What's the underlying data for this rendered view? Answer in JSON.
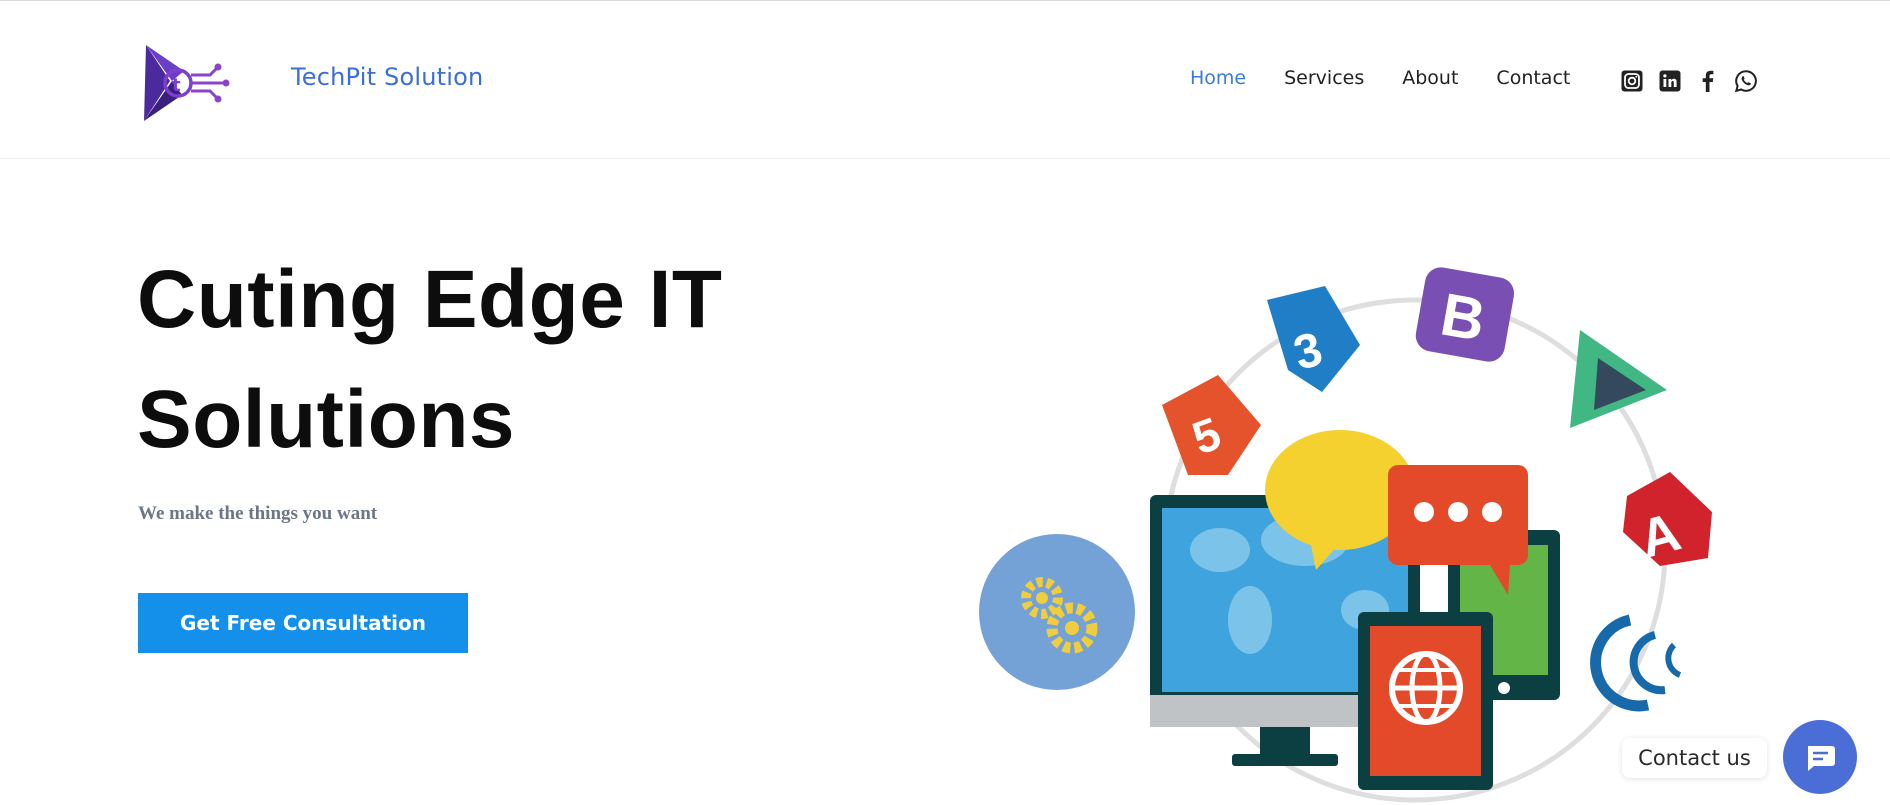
{
  "brand": {
    "name": "TechPit Solution",
    "logo_icon": "techpit-logo-icon"
  },
  "nav": {
    "items": [
      {
        "label": "Home",
        "active": true
      },
      {
        "label": "Services",
        "active": false
      },
      {
        "label": "About",
        "active": false
      },
      {
        "label": "Contact",
        "active": false
      }
    ]
  },
  "social": [
    "instagram-icon",
    "linkedin-icon",
    "facebook-icon",
    "whatsapp-icon"
  ],
  "hero": {
    "title_line1": "Cuting Edge IT",
    "title_line2": "Solutions",
    "subtitle": "We make the things you want",
    "cta_label": "Get Free Consultation"
  },
  "contact_widget": {
    "label": "Contact us",
    "icon": "chat-icon"
  },
  "colors": {
    "brand_blue": "#3b6fd6",
    "active_nav": "#3b7bd9",
    "cta_blue": "#1590ea",
    "fab_blue": "#4a6ed6"
  }
}
